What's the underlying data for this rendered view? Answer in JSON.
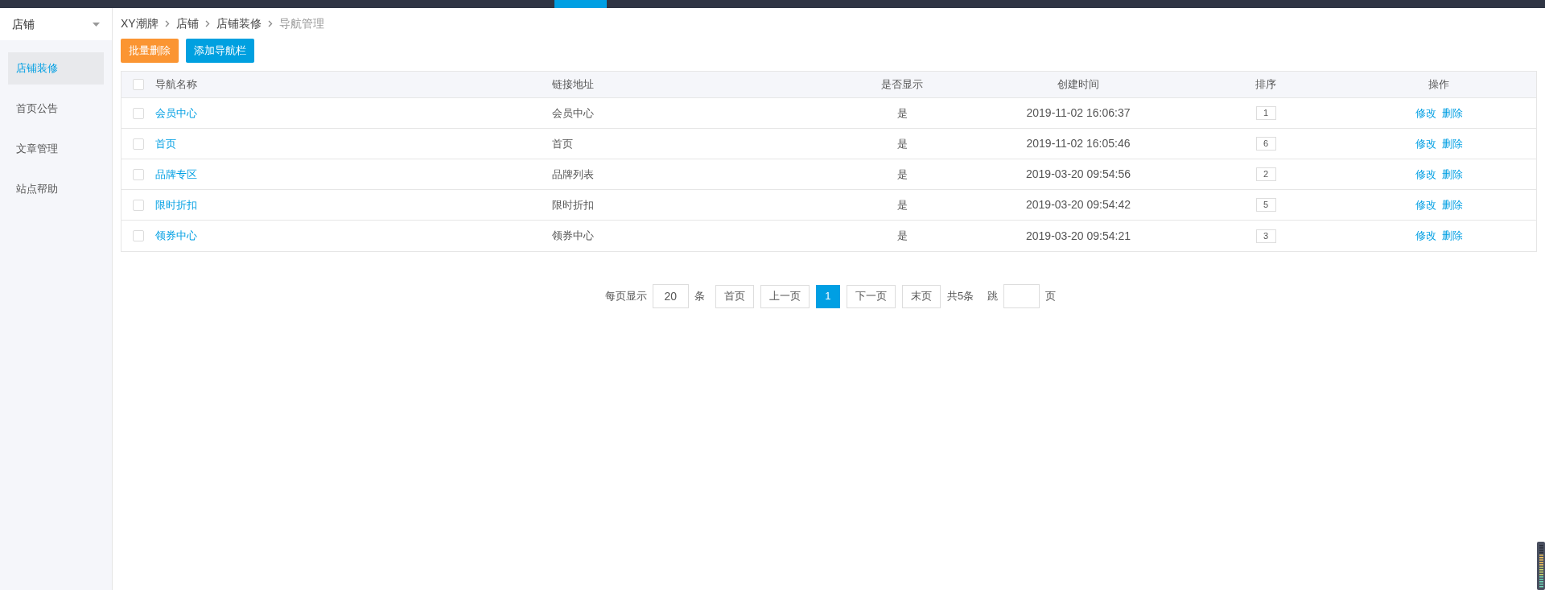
{
  "sidebar": {
    "title": "店铺",
    "items": [
      {
        "label": "店铺装修",
        "selected": true
      },
      {
        "label": "首页公告",
        "selected": false
      },
      {
        "label": "文章管理",
        "selected": false
      },
      {
        "label": "站点帮助",
        "selected": false
      }
    ]
  },
  "breadcrumb": [
    "XY潮牌",
    "店铺",
    "店铺装修",
    "导航管理"
  ],
  "actions": [
    {
      "label": "批量删除",
      "kind": "warning"
    },
    {
      "label": "添加导航栏",
      "kind": "primary"
    }
  ],
  "table": {
    "select_all": {
      "checked": false
    },
    "columns": [
      "导航名称",
      "链接地址",
      "是否显示",
      "创建时间",
      "排序",
      "操作"
    ],
    "rows": [
      {
        "checked": false,
        "name": "会员中心",
        "link": "会员中心",
        "visible": "是",
        "created": "2019-11-02 16:06:37",
        "order": "1",
        "ops": [
          "修改",
          "删除"
        ]
      },
      {
        "checked": false,
        "name": "首页",
        "link": "首页",
        "visible": "是",
        "created": "2019-11-02 16:05:46",
        "order": "6",
        "ops": [
          "修改",
          "删除"
        ]
      },
      {
        "checked": false,
        "name": "品牌专区",
        "link": "品牌列表",
        "visible": "是",
        "created": "2019-03-20 09:54:56",
        "order": "2",
        "ops": [
          "修改",
          "删除"
        ]
      },
      {
        "checked": false,
        "name": "限时折扣",
        "link": "限时折扣",
        "visible": "是",
        "created": "2019-03-20 09:54:42",
        "order": "5",
        "ops": [
          "修改",
          "删除"
        ]
      },
      {
        "checked": false,
        "name": "领券中心",
        "link": "领券中心",
        "visible": "是",
        "created": "2019-03-20 09:54:21",
        "order": "3",
        "ops": [
          "修改",
          "删除"
        ]
      }
    ]
  },
  "pagination": {
    "per_page_label": "每页显示",
    "per_page": "20",
    "per_page_unit": "条",
    "buttons": [
      {
        "label": "首页",
        "selected": false
      },
      {
        "label": "上一页",
        "selected": false
      },
      {
        "label": "1",
        "selected": true
      },
      {
        "label": "下一页",
        "selected": false
      },
      {
        "label": "末页",
        "selected": false
      }
    ],
    "total": "共5条",
    "jump_label": "跳",
    "jump_unit": "页"
  }
}
